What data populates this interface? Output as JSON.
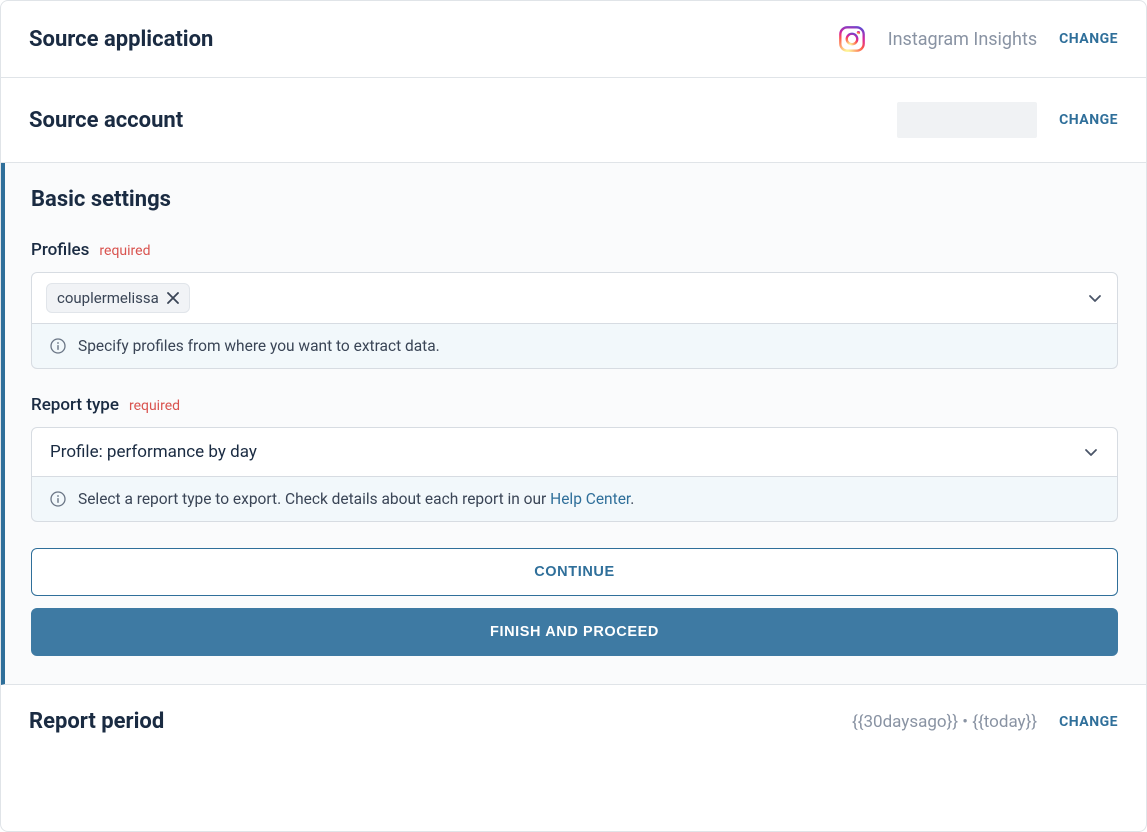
{
  "source_application": {
    "title": "Source application",
    "value": "Instagram Insights",
    "change_label": "CHANGE"
  },
  "source_account": {
    "title": "Source account",
    "change_label": "CHANGE"
  },
  "basic_settings": {
    "title": "Basic settings",
    "profiles": {
      "label": "Profiles",
      "required_label": "required",
      "selected_chip": "couplermelissa",
      "help": "Specify profiles from where you want to extract data."
    },
    "report_type": {
      "label": "Report type",
      "required_label": "required",
      "value": "Profile: performance by day",
      "help_pre": "Select a report type to export. Check details about each report in our ",
      "help_link": "Help Center",
      "help_post": "."
    },
    "continue_label": "CONTINUE",
    "finish_label": "FINISH AND PROCEED"
  },
  "report_period": {
    "title": "Report period",
    "value": "{{30daysago}} • {{today}}",
    "change_label": "CHANGE"
  }
}
